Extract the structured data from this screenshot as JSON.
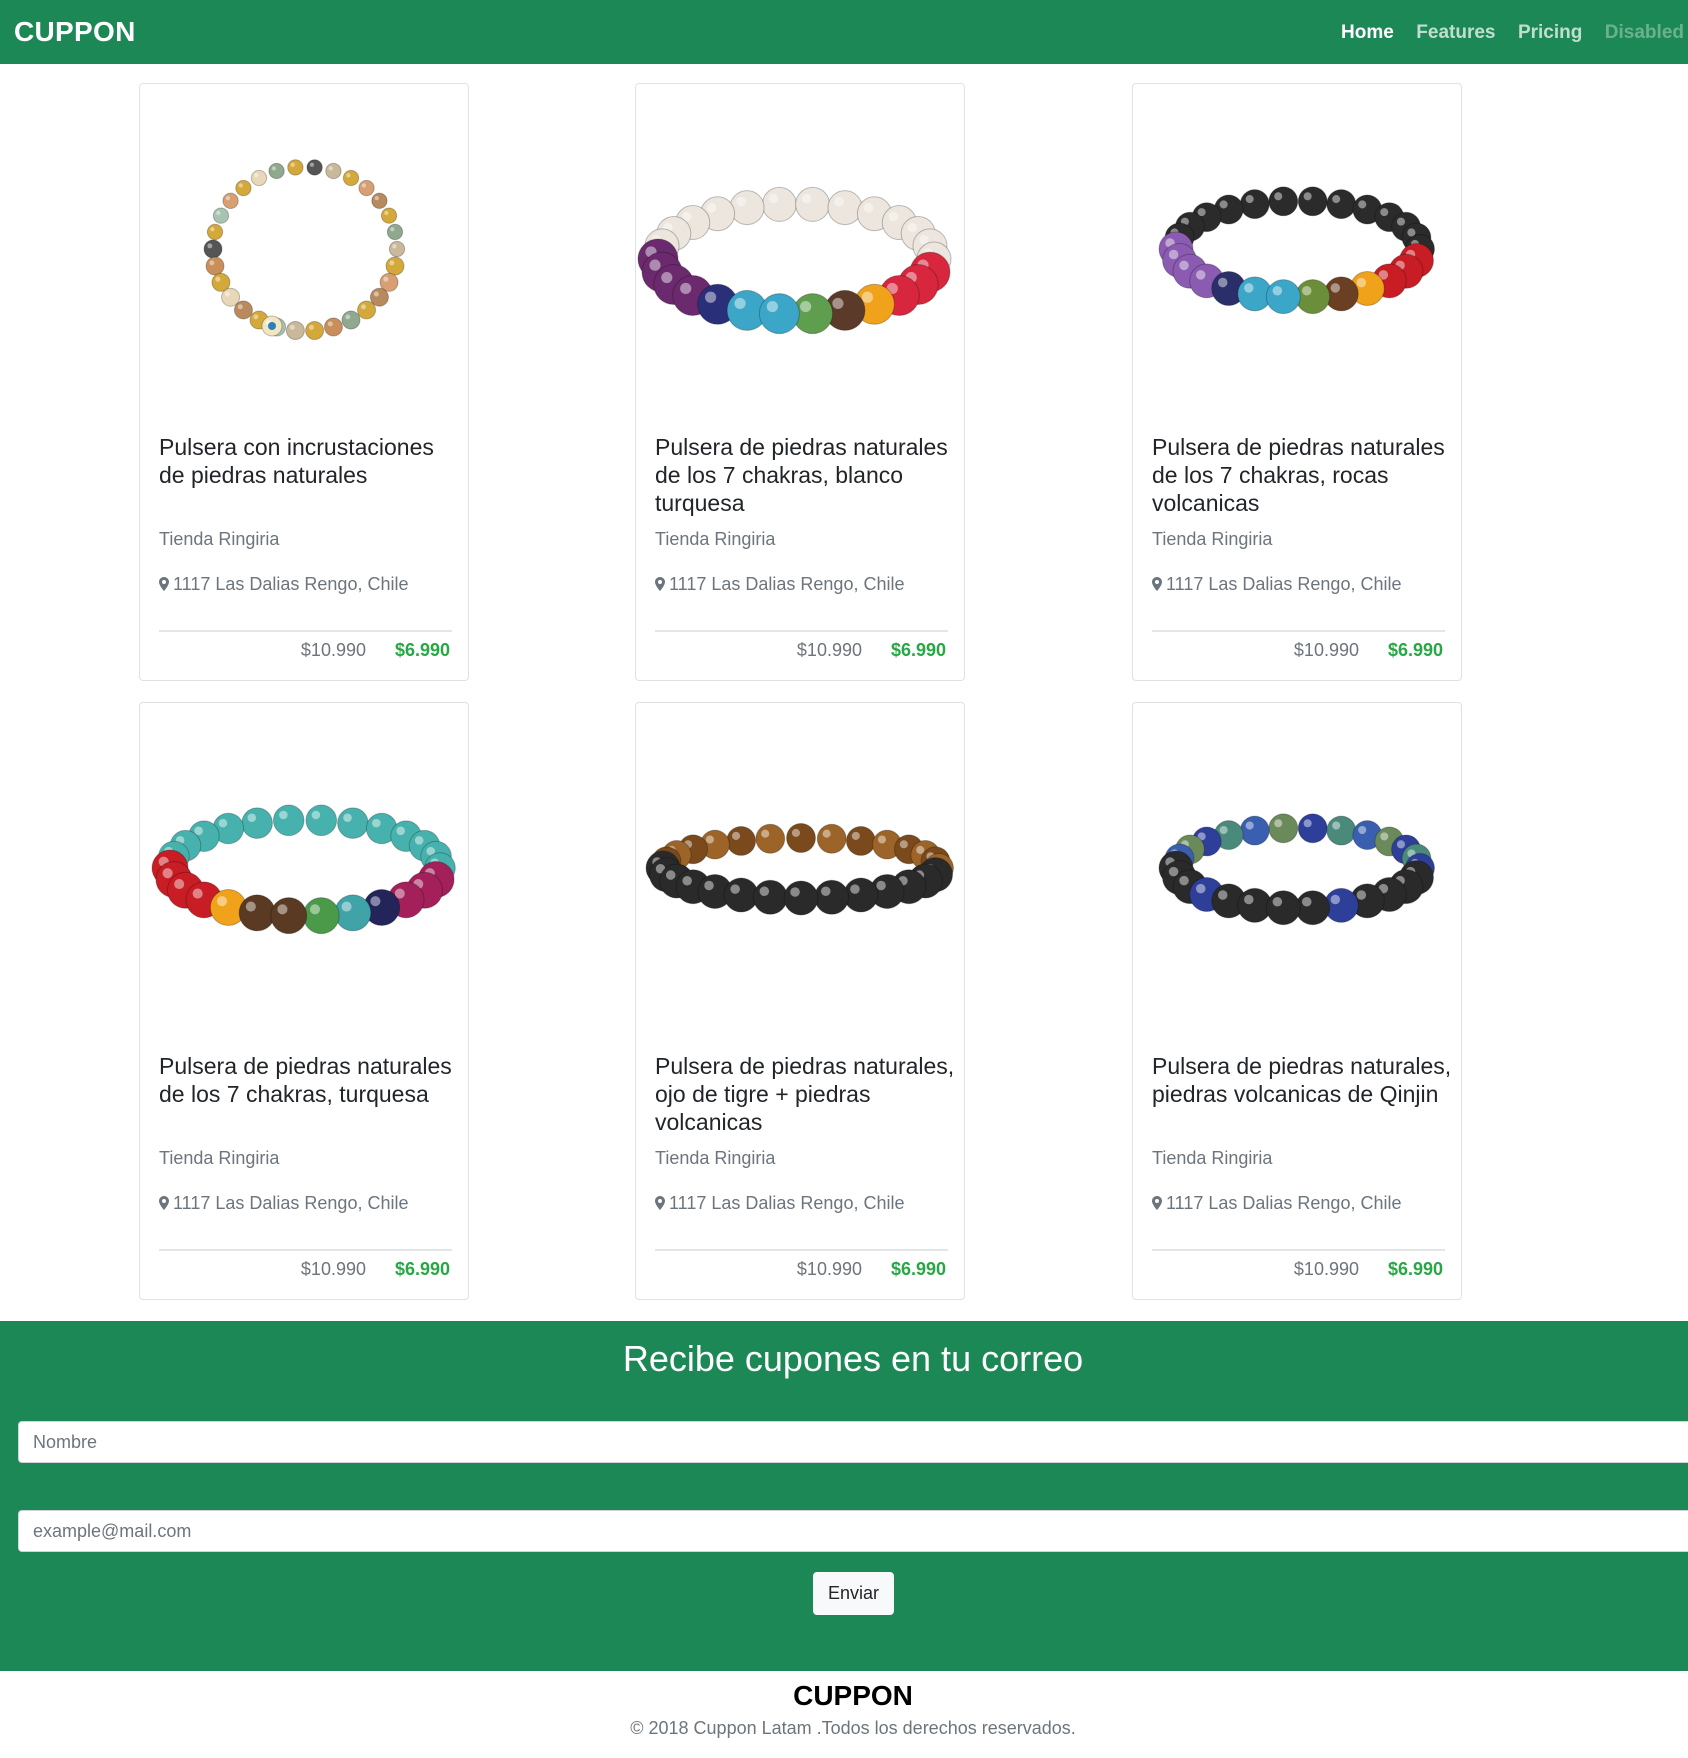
{
  "navbar": {
    "brand": "CUPPON",
    "links": [
      {
        "label": "Home",
        "state": "active"
      },
      {
        "label": "Features",
        "state": "normal"
      },
      {
        "label": "Pricing",
        "state": "normal"
      },
      {
        "label": "Disabled",
        "state": "disabled"
      }
    ]
  },
  "products": [
    {
      "title": "Pulsera con incrustaciones de piedras naturales",
      "store": "Tienda Ringiria",
      "address": "1117 Las Dalias Rengo, Chile",
      "price_old": "$10.990",
      "price_new": "$6.990",
      "image_icon": "bracelet-amazonite-gold-image"
    },
    {
      "title": "Pulsera de piedras naturales de los 7 chakras, blanco turquesa",
      "store": "Tienda Ringiria",
      "address": "1117 Las Dalias Rengo, Chile",
      "price_old": "$10.990",
      "price_new": "$6.990",
      "image_icon": "bracelet-white-chakra-image"
    },
    {
      "title": "Pulsera de piedras naturales de los 7 chakras, rocas volcanicas",
      "store": "Tienda Ringiria",
      "address": "1117 Las Dalias Rengo, Chile",
      "price_old": "$10.990",
      "price_new": "$6.990",
      "image_icon": "bracelet-lava-chakra-image"
    },
    {
      "title": "Pulsera de piedras naturales de los 7 chakras, turquesa",
      "store": "Tienda Ringiria",
      "address": "1117 Las Dalias Rengo, Chile",
      "price_old": "$10.990",
      "price_new": "$6.990",
      "image_icon": "bracelet-turquoise-chakra-image"
    },
    {
      "title": "Pulsera de piedras naturales, ojo de tigre + piedras volcanicas",
      "store": "Tienda Ringiria",
      "address": "1117 Las Dalias Rengo, Chile",
      "price_old": "$10.990",
      "price_new": "$6.990",
      "image_icon": "bracelet-tigereye-lava-image"
    },
    {
      "title": "Pulsera de piedras naturales, piedras volcanicas de Qinjin",
      "store": "Tienda Ringiria",
      "address": "1117 Las Dalias Rengo, Chile",
      "price_old": "$10.990",
      "price_new": "$6.990",
      "image_icon": "bracelet-lapis-lava-image"
    }
  ],
  "newsletter": {
    "title": "Recibe cupones en tu correo",
    "name_placeholder": "Nombre",
    "email_placeholder": "example@mail.com",
    "button_label": "Enviar"
  },
  "footer": {
    "brand": "CUPPON",
    "copyright": "© 2018 Cuppon Latam .Todos los derechos reservados."
  },
  "colors": {
    "brand_green": "#1c8855",
    "price_green": "#28a745"
  }
}
